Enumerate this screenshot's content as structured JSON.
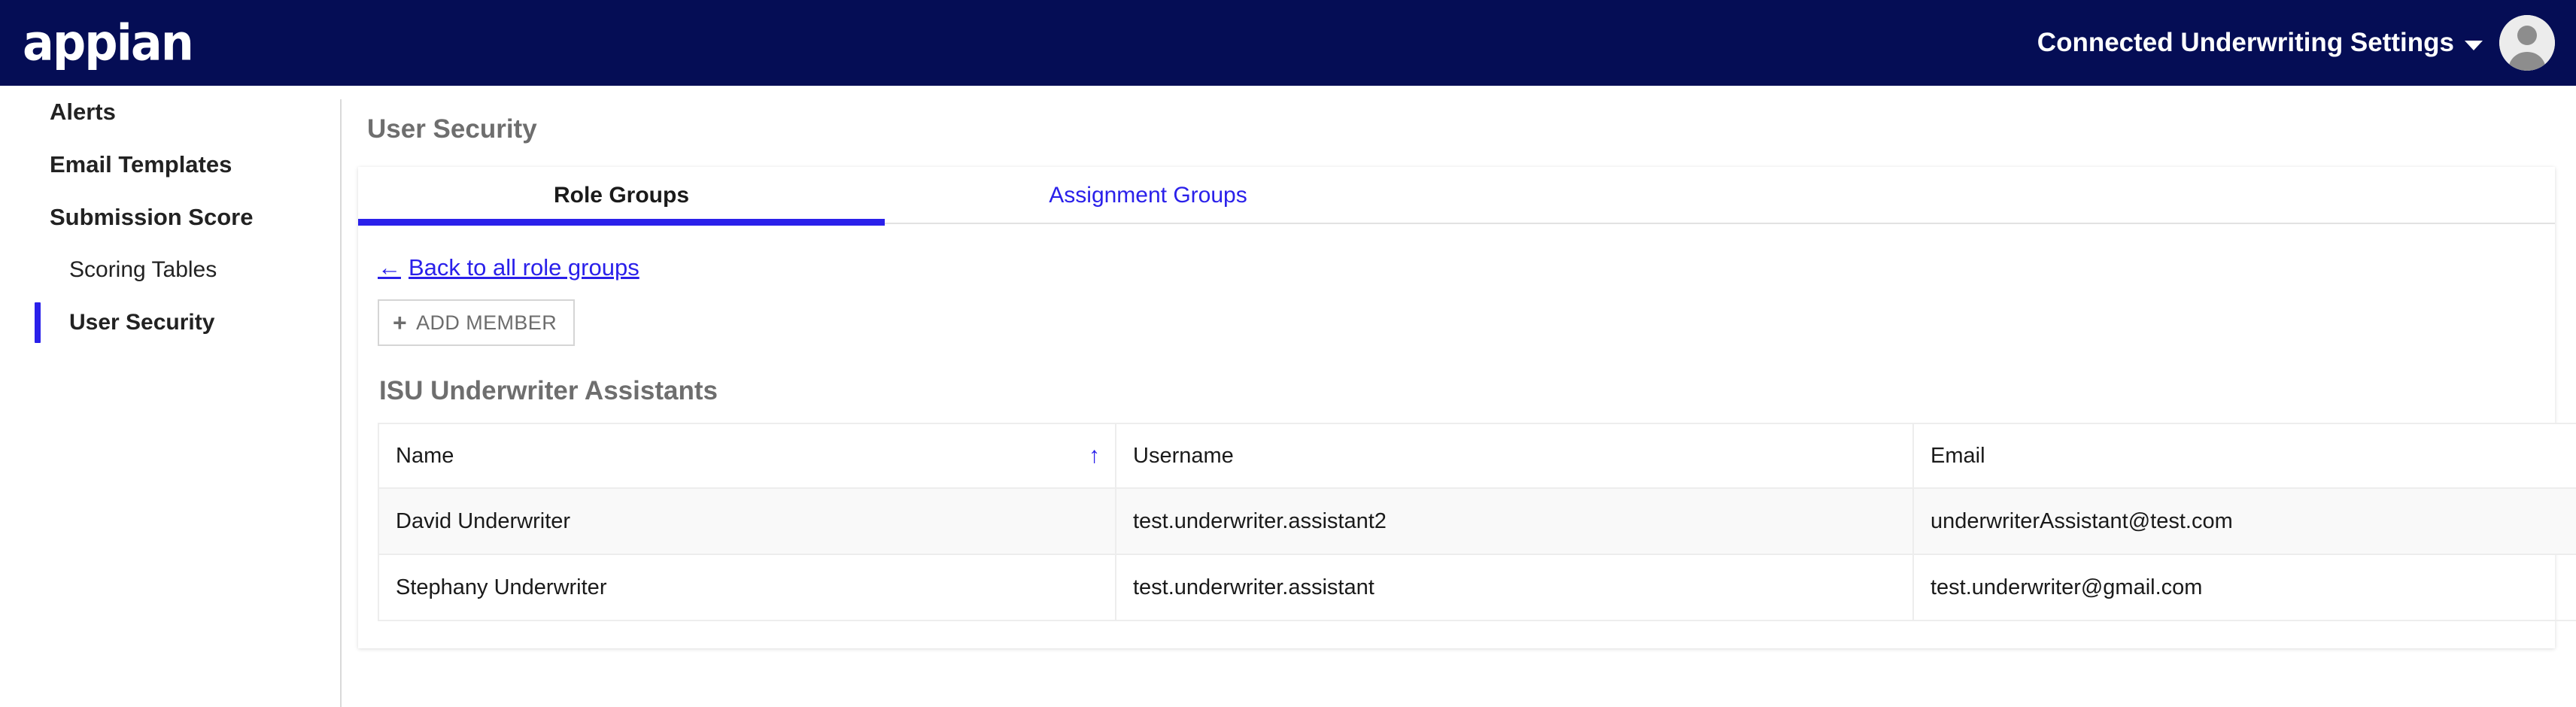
{
  "header": {
    "logo_text": "appian",
    "site_switcher_label": "Connected Underwriting Settings",
    "caret_icon": "chevron-down-icon",
    "avatar_icon": "user-avatar-icon"
  },
  "sidebar": {
    "items": [
      {
        "label": "Alerts",
        "level": 1,
        "active": false
      },
      {
        "label": "Email Templates",
        "level": 1,
        "active": false
      },
      {
        "label": "Submission Score",
        "level": 1,
        "active": false
      },
      {
        "label": "Scoring Tables",
        "level": 2,
        "active": false
      },
      {
        "label": "User Security",
        "level": 2,
        "active": true
      }
    ]
  },
  "main": {
    "page_title": "User Security",
    "tabs": [
      {
        "label": "Role Groups",
        "active": true
      },
      {
        "label": "Assignment Groups",
        "active": false
      }
    ],
    "back_link": {
      "arrow": "←",
      "label": "Back to all role groups"
    },
    "add_member_button": {
      "plus": "+",
      "label": "ADD MEMBER"
    },
    "group_title": "ISU Underwriter Assistants",
    "table": {
      "columns": [
        "Name",
        "Username",
        "Email",
        ""
      ],
      "sort": {
        "column": "Name",
        "direction": "ascending",
        "glyph": "↑"
      },
      "rows": [
        {
          "name": "David Underwriter",
          "username": "test.underwriter.assistant2",
          "email": "underwriterAssistant@test.com",
          "action_icon": "remove-user-icon"
        },
        {
          "name": "Stephany Underwriter",
          "username": "test.underwriter.assistant",
          "email": "test.underwriter@gmail.com",
          "action_icon": "remove-user-icon"
        }
      ]
    }
  },
  "colors": {
    "header_navy": "#050D55",
    "accent_blue": "#2A20EA",
    "muted_gray": "#6e6e6e",
    "row_alt": "#f9f9f9",
    "border": "#ededed"
  }
}
